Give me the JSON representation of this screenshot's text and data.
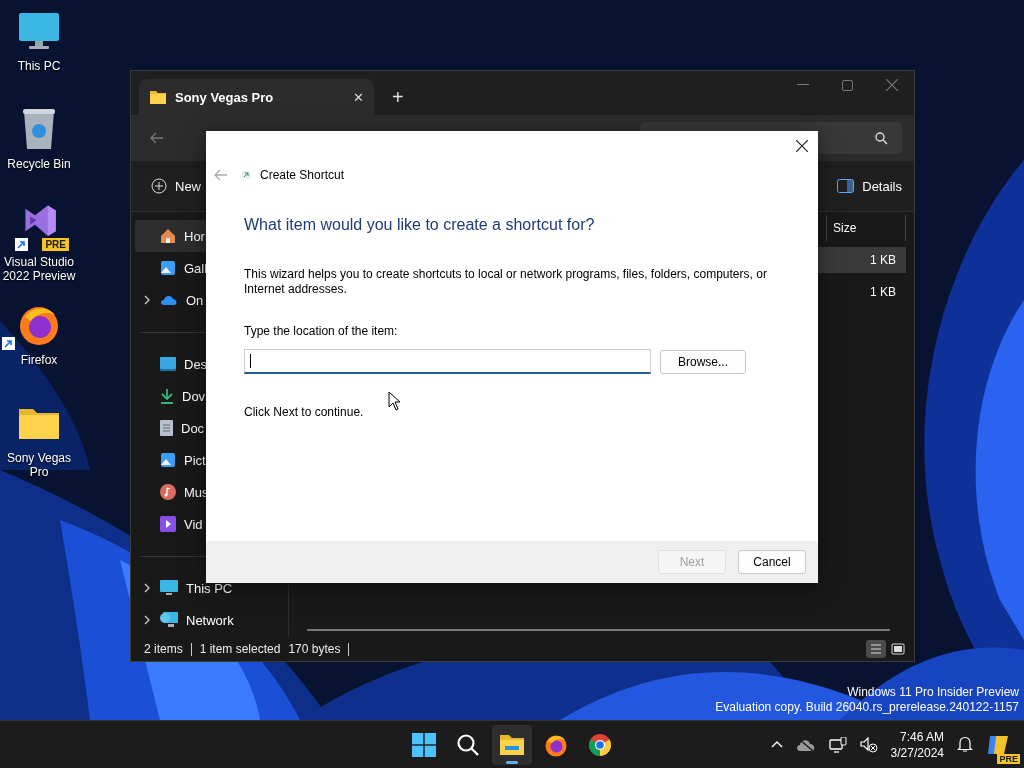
{
  "desktop_icons": [
    {
      "label": "This PC",
      "kind": "monitor",
      "shortcut": false
    },
    {
      "label": "Recycle Bin",
      "kind": "bin",
      "shortcut": false
    },
    {
      "label": "Visual Studio 2022 Preview",
      "kind": "vs",
      "shortcut": true,
      "badge": "PRE"
    },
    {
      "label": "Firefox",
      "kind": "firefox",
      "shortcut": true
    },
    {
      "label": "Sony Vegas Pro",
      "kind": "folder",
      "shortcut": false
    }
  ],
  "explorer": {
    "tabs": [
      {
        "label": "Sony Vegas Pro",
        "selected": true,
        "close": "✕"
      }
    ],
    "new_tab": "+",
    "command_bar": {
      "new": "New",
      "details": "Details"
    },
    "sidebar": {
      "groups": [
        [
          {
            "label": "Hor",
            "kind": "home",
            "selected": true,
            "expandable": false
          },
          {
            "label": "Gall",
            "kind": "gallery",
            "selected": false,
            "expandable": false
          },
          {
            "label": "On",
            "kind": "cloud",
            "selected": false,
            "expandable": true
          }
        ],
        [
          {
            "label": "Des",
            "kind": "desktop",
            "selected": false,
            "expandable": false
          },
          {
            "label": "Dov",
            "kind": "download",
            "selected": false,
            "expandable": false
          },
          {
            "label": "Doc",
            "kind": "document",
            "selected": false,
            "expandable": false
          },
          {
            "label": "Pict",
            "kind": "gallery",
            "selected": false,
            "expandable": false
          },
          {
            "label": "Mus",
            "kind": "music",
            "selected": false,
            "expandable": false
          },
          {
            "label": "Vid",
            "kind": "video",
            "selected": false,
            "expandable": false
          }
        ],
        [
          {
            "label": "This PC",
            "kind": "monitor",
            "selected": false,
            "expandable": true
          },
          {
            "label": "Network",
            "kind": "network",
            "selected": false,
            "expandable": true
          }
        ]
      ]
    },
    "columns": [
      "Size"
    ],
    "rows": [
      {
        "size": "1 KB",
        "selected": true
      },
      {
        "size": "1 KB",
        "selected": false
      }
    ],
    "status_bar": [
      "2 items",
      "1 item selected",
      "170 bytes"
    ],
    "views": [
      {
        "kind": "details",
        "selected": true
      },
      {
        "kind": "tiles",
        "selected": false
      }
    ]
  },
  "dialog": {
    "title": "Create Shortcut",
    "heading": "What item would you like to create a shortcut for?",
    "description": "This wizard helps you to create shortcuts to local or network programs, files, folders, computers, or Internet addresses.",
    "field_label": "Type the location of the item:",
    "browse": "Browse...",
    "hint": "Click Next to continue.",
    "buttons": [
      {
        "label": "Next",
        "disabled": true
      },
      {
        "label": "Cancel",
        "disabled": false
      }
    ]
  },
  "watermark": [
    "Windows 11 Pro Insider Preview",
    "Evaluation copy. Build 26040.rs_prerelease.240122-1157"
  ],
  "taskbar": {
    "apps": [
      {
        "kind": "start",
        "active": false
      },
      {
        "kind": "search",
        "active": false
      },
      {
        "kind": "explorer",
        "active": true
      },
      {
        "kind": "firefox",
        "active": false
      },
      {
        "kind": "chrome",
        "active": false
      }
    ],
    "time": "7:46 AM",
    "date": "3/27/2024",
    "copilot_badge": "PRE"
  }
}
